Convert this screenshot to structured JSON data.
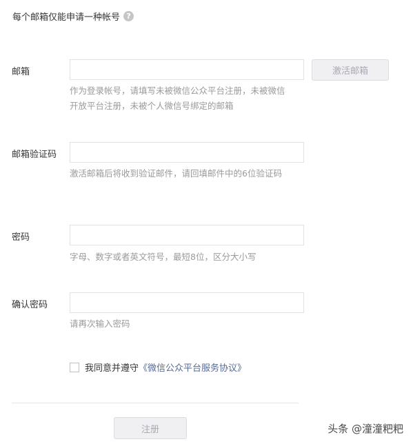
{
  "notice": {
    "text": "每个邮箱仅能申请一种帐号",
    "help_icon_glyph": "?"
  },
  "email": {
    "label": "邮箱",
    "value": "",
    "placeholder": "",
    "activate_button": "激活邮箱",
    "hint": "作为登录帐号，请填写未被微信公众平台注册，未被微信开放平台注册，未被个人微信号绑定的邮箱"
  },
  "verify_code": {
    "label": "邮箱验证码",
    "value": "",
    "hint": "激活邮箱后将收到验证邮件，请回填邮件中的6位验证码"
  },
  "password": {
    "label": "密码",
    "value": "",
    "hint": "字母、数字或者英文符号，最短8位，区分大小写"
  },
  "confirm_password": {
    "label": "确认密码",
    "value": "",
    "hint": "请再次输入密码"
  },
  "agreement": {
    "prefix": "我同意并遵守",
    "link": "《微信公众平台服务协议》",
    "checked": false
  },
  "submit": {
    "label": "注册"
  },
  "watermark": {
    "text": "头条 @潼潼粑粑"
  },
  "colors": {
    "link": "#576b95",
    "hint": "#9a9a9a",
    "disabled_button_bg": "#f0f0f2"
  }
}
